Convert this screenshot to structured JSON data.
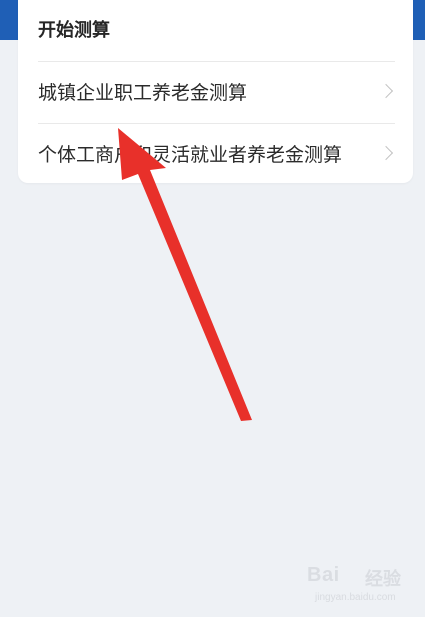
{
  "header": {
    "title": "开始测算"
  },
  "options": [
    {
      "label": "城镇企业职工养老金测算",
      "chevron_icon": "chevron-right-icon"
    },
    {
      "label": "个体工商户和灵活就业者养老金测算",
      "chevron_icon": "chevron-right-icon"
    }
  ],
  "annotation": {
    "arrow_color": "#e8302a"
  },
  "watermark": {
    "brand": "Bai",
    "brand_suffix": "经验",
    "url": "jingyan.baidu.com"
  },
  "colors": {
    "top_band": "#1f5fb6",
    "background": "#eef1f5",
    "card": "#ffffff"
  }
}
